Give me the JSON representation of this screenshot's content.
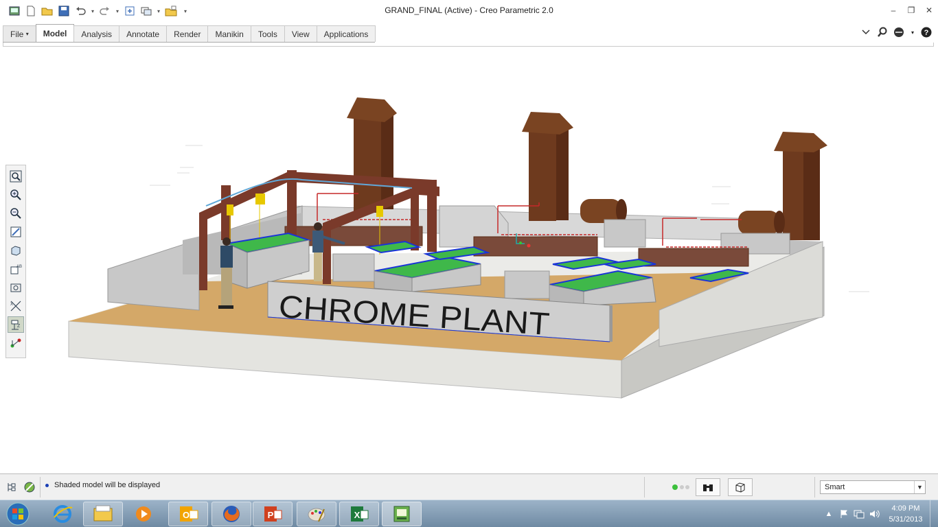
{
  "window": {
    "title": "GRAND_FINAL (Active) - Creo Parametric 2.0"
  },
  "quick_access": [
    {
      "icon": "regenerate-icon"
    },
    {
      "icon": "new-file-icon"
    },
    {
      "icon": "open-file-icon"
    },
    {
      "icon": "save-icon"
    },
    {
      "icon": "undo-icon"
    },
    {
      "icon": "redo-icon"
    },
    {
      "icon": "regenerate-model-icon"
    },
    {
      "icon": "windows-icon"
    },
    {
      "icon": "close-window-icon"
    },
    {
      "icon": "customize-qa-icon"
    }
  ],
  "ribbon": {
    "tabs": [
      {
        "label": "File",
        "dropdown": true
      },
      {
        "label": "Model",
        "active": true
      },
      {
        "label": "Analysis"
      },
      {
        "label": "Annotate"
      },
      {
        "label": "Render"
      },
      {
        "label": "Manikin"
      },
      {
        "label": "Tools"
      },
      {
        "label": "View"
      },
      {
        "label": "Applications"
      }
    ]
  },
  "left_toolbar": [
    {
      "icon": "refit-icon"
    },
    {
      "icon": "zoom-in-icon"
    },
    {
      "icon": "zoom-out-icon"
    },
    {
      "icon": "repaint-icon"
    },
    {
      "icon": "display-style-icon"
    },
    {
      "icon": "saved-orientations-icon"
    },
    {
      "icon": "view-manager-icon"
    },
    {
      "icon": "datum-display-icon"
    },
    {
      "icon": "annotation-display-icon",
      "selected": true
    },
    {
      "icon": "spin-center-icon"
    }
  ],
  "model": {
    "sign_text": "CHROME PLANT",
    "colors": {
      "floor": "#d4a868",
      "base_light": "#e6e6e2",
      "base_dark": "#c8c8c4",
      "wall": "#c4c4c4",
      "frame": "#7a3a2a",
      "stack": "#6e3a1e",
      "tank_green": "#3fb84a",
      "tank_blue": "#1a34d8"
    }
  },
  "status": {
    "message": "Shaded model will be displayed",
    "filter_value": "Smart"
  },
  "taskbar": {
    "apps": [
      {
        "icon": "internet-explorer-icon"
      },
      {
        "icon": "file-explorer-icon"
      },
      {
        "icon": "media-player-icon"
      },
      {
        "icon": "outlook-icon"
      },
      {
        "icon": "firefox-icon"
      },
      {
        "icon": "powerpoint-icon"
      },
      {
        "icon": "paint-icon"
      },
      {
        "icon": "excel-icon"
      },
      {
        "icon": "creo-icon"
      }
    ],
    "clock_time": "4:09 PM",
    "clock_date": "5/31/2013"
  }
}
